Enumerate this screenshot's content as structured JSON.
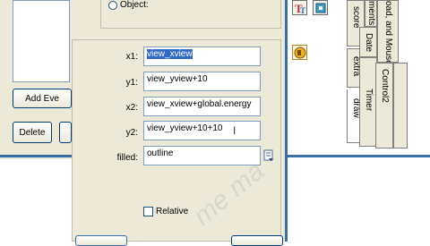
{
  "background_panel": {
    "add_event_label": "Add Eve",
    "delete_label": "Delete"
  },
  "dialog": {
    "object_label": "Object:",
    "fields": [
      {
        "label": "x1:",
        "value": "view_xview",
        "selected": true
      },
      {
        "label": "y1:",
        "value": "view_yview+10"
      },
      {
        "label": "x2:",
        "value": "view_xview+global.energy"
      },
      {
        "label": "y2:",
        "value": "view_yview+10+10"
      }
    ],
    "filled": {
      "label": "filled:",
      "value": "outline"
    },
    "relative_label": "Relative"
  },
  "event_tabs": {
    "col1": [
      "score",
      "extra",
      "draw"
    ],
    "col2": [
      "ments",
      "Date",
      "Timer"
    ],
    "col3": [
      "oad, and Mouse",
      "Control2"
    ]
  },
  "watermark": "me ma"
}
